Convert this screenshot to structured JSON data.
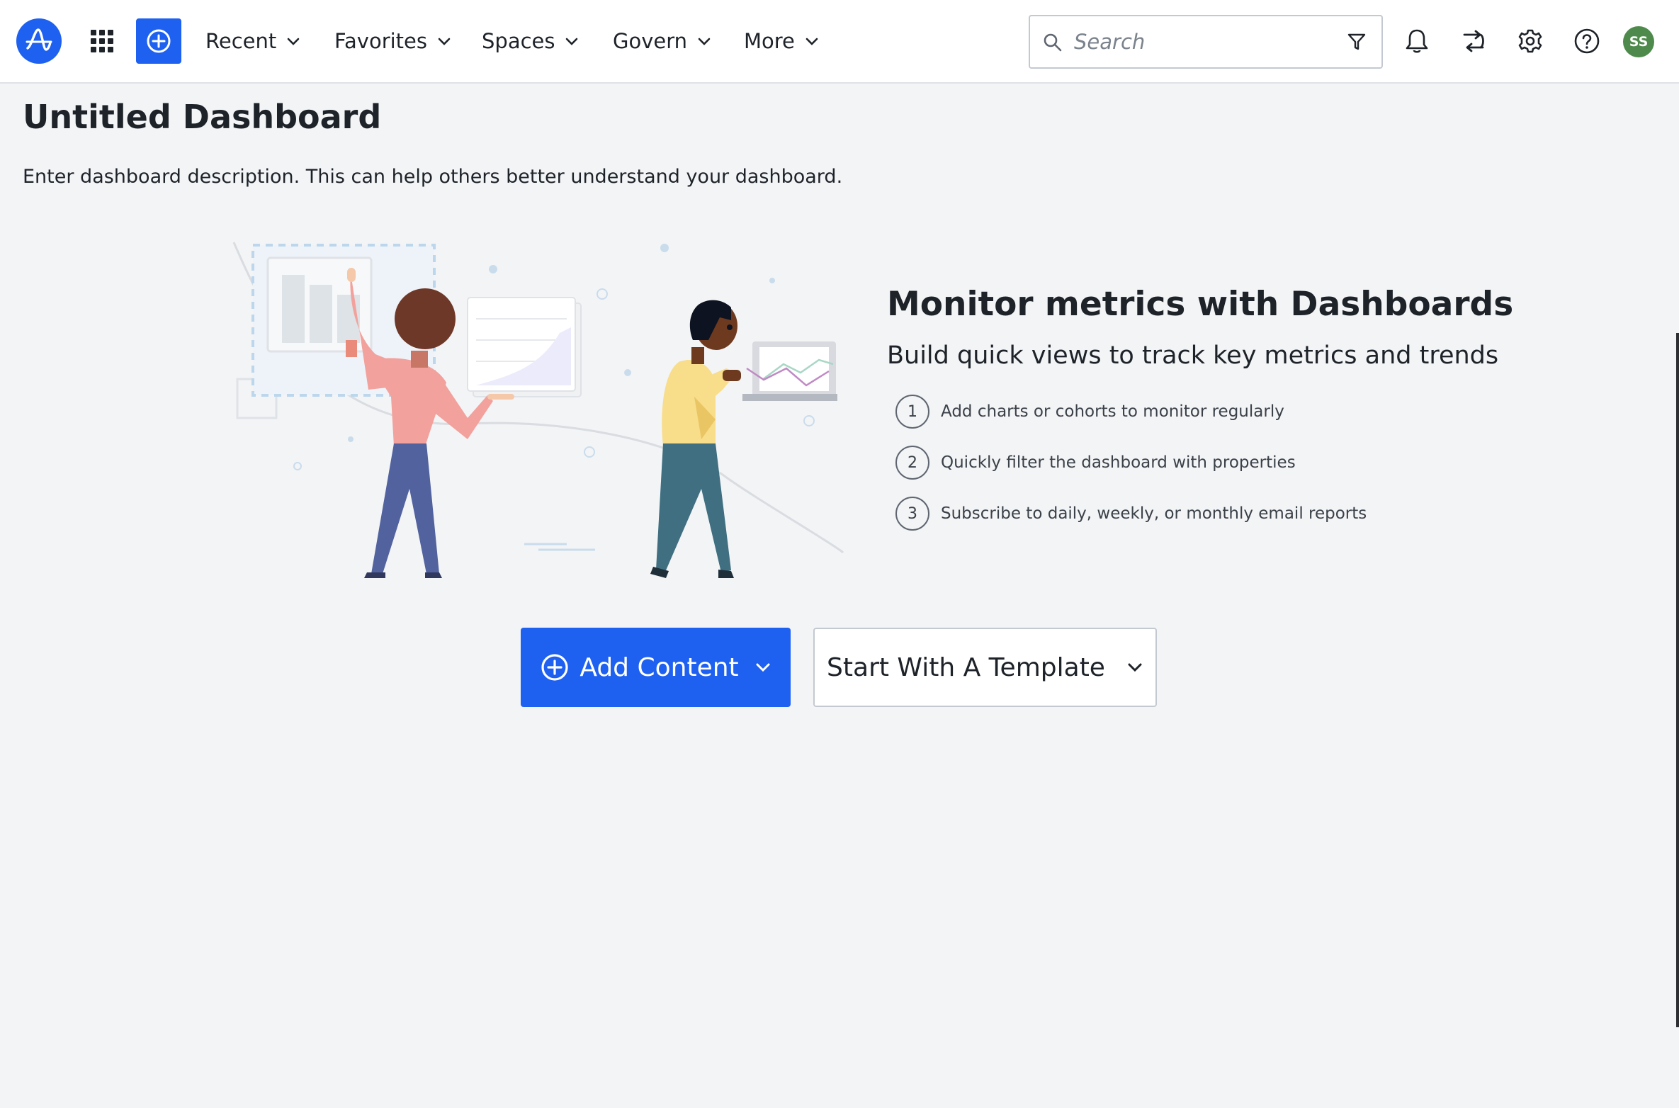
{
  "nav": {
    "recent": "Recent",
    "favorites": "Favorites",
    "spaces": "Spaces",
    "govern": "Govern",
    "more": "More",
    "search_placeholder": "Search",
    "avatar_initials": "SS"
  },
  "page": {
    "title": "Untitled Dashboard",
    "description": "Enter dashboard description. This can help others better understand your dashboard."
  },
  "info": {
    "title": "Monitor metrics with Dashboards",
    "subtitle": "Build quick views to track key metrics and trends",
    "steps": [
      {
        "num": "1",
        "text": "Add charts or cohorts to monitor regularly"
      },
      {
        "num": "2",
        "text": "Quickly filter the dashboard with properties"
      },
      {
        "num": "3",
        "text": "Subscribe to daily, weekly, or monthly email reports"
      }
    ]
  },
  "actions": {
    "add_content": "Add Content",
    "template": "Start With A Template"
  },
  "colors": {
    "brand": "#1e61f0",
    "avatar": "#4e8a4c",
    "background": "#f3f4f6"
  },
  "icons": [
    "logo-icon",
    "apps-grid-icon",
    "plus-circle-icon",
    "chevron-down-icon",
    "search-icon",
    "filter-icon",
    "bell-icon",
    "swap-icon",
    "gear-icon",
    "help-icon"
  ]
}
